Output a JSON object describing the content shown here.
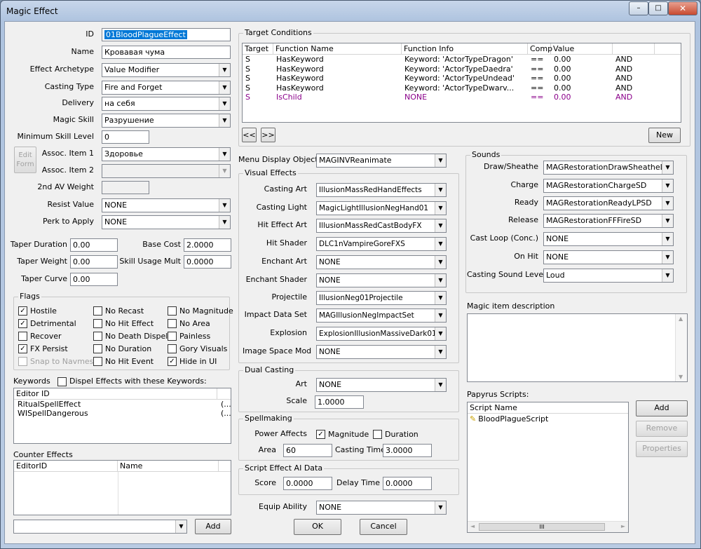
{
  "window": {
    "title": "Magic Effect",
    "minimize": "–",
    "maximize": "□",
    "close": "✕"
  },
  "main": {
    "id_label": "ID",
    "id_value": "01BloodPlagueEffect",
    "name_label": "Name",
    "name_value": "Кровавая чума",
    "archetype_label": "Effect Archetype",
    "archetype_value": "Value Modifier",
    "casting_type_label": "Casting Type",
    "casting_type_value": "Fire and Forget",
    "delivery_label": "Delivery",
    "delivery_value": "на себя",
    "magic_skill_label": "Magic Skill",
    "magic_skill_value": "Разрушение",
    "min_skill_label": "Minimum Skill Level",
    "min_skill_value": "0",
    "edit_form_label": "Edit Form",
    "assoc1_label": "Assoc. Item 1",
    "assoc1_value": "Здоровье",
    "assoc2_label": "Assoc. Item 2",
    "assoc2_value": "",
    "second_av_label": "2nd AV Weight",
    "second_av_value": "",
    "resist_label": "Resist Value",
    "resist_value": "NONE",
    "perk_label": "Perk to Apply",
    "perk_value": "NONE",
    "taper_duration_label": "Taper Duration",
    "taper_duration_value": "0.00",
    "base_cost_label": "Base Cost",
    "base_cost_value": "2.0000",
    "taper_weight_label": "Taper Weight",
    "taper_weight_value": "0.00",
    "skill_mult_label": "Skill Usage Mult",
    "skill_mult_value": "0.0000",
    "taper_curve_label": "Taper Curve",
    "taper_curve_value": "0.00"
  },
  "flags": {
    "title": "Flags",
    "items": [
      {
        "label": "Hostile",
        "checked": true,
        "mark": "✓"
      },
      {
        "label": "No Recast",
        "checked": false,
        "mark": ""
      },
      {
        "label": "No Magnitude",
        "checked": false,
        "mark": ""
      },
      {
        "label": "Detrimental",
        "checked": true,
        "mark": "✓"
      },
      {
        "label": "No Hit Effect",
        "checked": false,
        "mark": ""
      },
      {
        "label": "No Area",
        "checked": false,
        "mark": ""
      },
      {
        "label": "Recover",
        "checked": false,
        "mark": ""
      },
      {
        "label": "No Death Dispel",
        "checked": false,
        "mark": ""
      },
      {
        "label": "Painless",
        "checked": false,
        "mark": ""
      },
      {
        "label": "FX Persist",
        "checked": true,
        "mark": "✓"
      },
      {
        "label": "No Duration",
        "checked": false,
        "mark": ""
      },
      {
        "label": "Gory Visuals",
        "checked": false,
        "mark": ""
      },
      {
        "label": "Snap to Navmesh",
        "checked": false,
        "mark": ""
      },
      {
        "label": "No Hit Event",
        "checked": false,
        "mark": ""
      },
      {
        "label": "Hide in UI",
        "checked": true,
        "mark": "✓"
      }
    ]
  },
  "keywords": {
    "label": "Keywords",
    "dispel_label": "Dispel Effects with these Keywords:",
    "col_editor_id": "Editor ID",
    "rows": [
      {
        "id": "RitualSpellEffect",
        "extra": "(..."
      },
      {
        "id": "WISpellDangerous",
        "extra": "(..."
      }
    ]
  },
  "counter": {
    "label": "Counter Effects",
    "col_editor_id": "EditorID",
    "col_name": "Name",
    "add_label": "Add",
    "combo_value": ""
  },
  "target_conditions": {
    "title": "Target Conditions",
    "columns": [
      "Target",
      "Function Name",
      "Function Info",
      "Comp",
      "Value",
      ""
    ],
    "rows": [
      {
        "target": "S",
        "func": "HasKeyword",
        "info": "Keyword: 'ActorTypeDragon'",
        "comp": "==",
        "value": "0.00",
        "op": "AND",
        "purple": false
      },
      {
        "target": "S",
        "func": "HasKeyword",
        "info": "Keyword: 'ActorTypeDaedra'",
        "comp": "==",
        "value": "0.00",
        "op": "AND",
        "purple": false
      },
      {
        "target": "S",
        "func": "HasKeyword",
        "info": "Keyword: 'ActorTypeUndead'",
        "comp": "==",
        "value": "0.00",
        "op": "AND",
        "purple": false
      },
      {
        "target": "S",
        "func": "HasKeyword",
        "info": "Keyword: 'ActorTypeDwarv...",
        "comp": "==",
        "value": "0.00",
        "op": "AND",
        "purple": false
      },
      {
        "target": "S",
        "func": "IsChild",
        "info": "NONE",
        "comp": "==",
        "value": "0.00",
        "op": "AND",
        "purple": true
      }
    ],
    "prev": "<<",
    "next": ">>",
    "new_label": "New"
  },
  "menu_display": {
    "label": "Menu Display Object",
    "value": "MAGINVReanimate"
  },
  "visual_effects": {
    "title": "Visual Effects",
    "items": [
      {
        "label": "Casting Art",
        "value": "IllusionMassRedHandEffects"
      },
      {
        "label": "Casting Light",
        "value": "MagicLightIllusionNegHand01"
      },
      {
        "label": "Hit Effect Art",
        "value": "IllusionMassRedCastBodyFX"
      },
      {
        "label": "Hit Shader",
        "value": "DLC1nVampireGoreFXS"
      },
      {
        "label": "Enchant Art",
        "value": "NONE"
      },
      {
        "label": "Enchant Shader",
        "value": "NONE"
      },
      {
        "label": "Projectile",
        "value": "IllusionNeg01Projectile"
      },
      {
        "label": "Impact Data Set",
        "value": "MAGIllusionNegImpactSet"
      },
      {
        "label": "Explosion",
        "value": "ExplosionIllusionMassiveDark01"
      },
      {
        "label": "Image Space Mod",
        "value": "NONE"
      }
    ]
  },
  "dual_casting": {
    "title": "Dual Casting",
    "art_label": "Art",
    "art_value": "NONE",
    "scale_label": "Scale",
    "scale_value": "1.0000"
  },
  "spellmaking": {
    "title": "Spellmaking",
    "power_label": "Power Affects",
    "magnitude_label": "Magnitude",
    "magnitude_mark": "✓",
    "duration_label": "Duration",
    "duration_mark": "",
    "area_label": "Area",
    "area_value": "60",
    "casting_time_label": "Casting Time",
    "casting_time_value": "3.0000"
  },
  "script_ai": {
    "title": "Script Effect AI Data",
    "score_label": "Score",
    "score_value": "0.0000",
    "delay_label": "Delay Time",
    "delay_value": "0.0000"
  },
  "equip": {
    "label": "Equip Ability",
    "value": "NONE"
  },
  "buttons": {
    "ok": "OK",
    "cancel": "Cancel"
  },
  "sounds": {
    "title": "Sounds",
    "items": [
      {
        "label": "Draw/Sheathe",
        "value": "MAGRestorationDrawSheatheLPMSD"
      },
      {
        "label": "Charge",
        "value": "MAGRestorationChargeSD"
      },
      {
        "label": "Ready",
        "value": "MAGRestorationReadyLPSD"
      },
      {
        "label": "Release",
        "value": "MAGRestorationFFFireSD"
      },
      {
        "label": "Cast Loop (Conc.)",
        "value": "NONE"
      },
      {
        "label": "On Hit",
        "value": "NONE"
      }
    ],
    "level_label": "Casting Sound Level",
    "level_value": "Loud"
  },
  "description": {
    "label": "Magic item description",
    "value": ""
  },
  "papyrus": {
    "label": "Papyrus Scripts:",
    "col_script": "Script Name",
    "scripts": [
      "BloodPlagueScript"
    ],
    "add_label": "Add",
    "remove_label": "Remove",
    "properties_label": "Properties",
    "scroll_mark": "III"
  }
}
